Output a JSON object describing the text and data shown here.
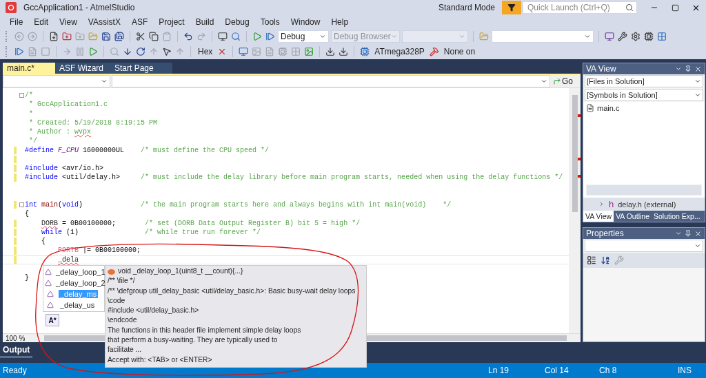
{
  "window": {
    "title": "GccApplication1 - AtmelStudio",
    "mode": "Standard Mode",
    "quick_launch": {
      "placeholder": "Quick Launch (Ctrl+Q)"
    }
  },
  "menu": [
    "File",
    "Edit",
    "View",
    "VAssistX",
    "ASF",
    "Project",
    "Build",
    "Debug",
    "Tools",
    "Window",
    "Help"
  ],
  "toolbar_1": {
    "configuration": "Debug",
    "debug_browser": "Debug Browser"
  },
  "toolbar_2": {
    "hex": "Hex",
    "device": "ATmega328P",
    "tool": "None on"
  },
  "document_tabs": [
    {
      "label": "main.c*",
      "selected": true
    },
    {
      "label": "ASF Wizard",
      "selected": false
    },
    {
      "label": "Start Page",
      "selected": false
    }
  ],
  "editor": {
    "go": "Go",
    "zoom": "100 %",
    "lines": [
      {
        "changed": false,
        "fold": true,
        "current": false,
        "segments": [
          {
            "text": "/*",
            "kind": "comment"
          }
        ]
      },
      {
        "changed": false,
        "fold": false,
        "current": false,
        "segments": [
          {
            "text": " * GccApplication1.c",
            "kind": "comment"
          }
        ]
      },
      {
        "changed": false,
        "fold": false,
        "current": false,
        "segments": [
          {
            "text": " *",
            "kind": "comment"
          }
        ]
      },
      {
        "changed": false,
        "fold": false,
        "current": false,
        "segments": [
          {
            "text": " * Created: 5/19/2018 8:19:15 PM",
            "kind": "comment"
          }
        ]
      },
      {
        "changed": false,
        "fold": false,
        "current": false,
        "segments": [
          {
            "text": " * Author : ",
            "kind": "comment"
          },
          {
            "text": "wvpx",
            "kind": "comment_error"
          }
        ]
      },
      {
        "changed": false,
        "fold": false,
        "current": false,
        "segments": [
          {
            "text": " */",
            "kind": "comment"
          }
        ]
      },
      {
        "changed": true,
        "fold": false,
        "current": false,
        "segments": [
          {
            "text": "#define ",
            "kind": "keyword"
          },
          {
            "text": "F_CPU",
            "kind": "macro"
          },
          {
            "text": " 16000000UL    ",
            "kind": "plain"
          },
          {
            "text": "/* must define the CPU speed */",
            "kind": "comment"
          }
        ]
      },
      {
        "changed": true,
        "fold": false,
        "current": false
      },
      {
        "changed": true,
        "fold": false,
        "current": false,
        "segments": [
          {
            "text": "#include",
            "kind": "keyword"
          },
          {
            "text": " <avr/io.h>",
            "kind": "plain"
          }
        ]
      },
      {
        "changed": true,
        "fold": false,
        "current": false,
        "segments": [
          {
            "text": "#include",
            "kind": "keyword"
          },
          {
            "text": " <util/delay.h>     ",
            "kind": "plain"
          },
          {
            "text": "/* must include the delay library before main program starts, needed when using the delay functions */",
            "kind": "comment"
          }
        ]
      },
      {
        "changed": false,
        "fold": false,
        "current": false
      },
      {
        "changed": false,
        "fold": false,
        "current": false
      },
      {
        "changed": true,
        "fold": true,
        "current": false,
        "segments": [
          {
            "text": "int ",
            "kind": "keyword"
          },
          {
            "text": "main",
            "kind": "function"
          },
          {
            "text": "(",
            "kind": "plain"
          },
          {
            "text": "void",
            "kind": "keyword"
          },
          {
            "text": ")              ",
            "kind": "plain"
          },
          {
            "text": "/* the main program starts here and always begins with int main(void)    */",
            "kind": "comment"
          }
        ]
      },
      {
        "changed": false,
        "fold": false,
        "current": false,
        "segments": [
          {
            "text": "{",
            "kind": "plain"
          }
        ]
      },
      {
        "changed": true,
        "fold": false,
        "current": false,
        "segments": [
          {
            "text": "    DORB",
            "kind": "error"
          },
          {
            "text": " = 0B00100000;       ",
            "kind": "plain"
          },
          {
            "text": "/* set (DORB Data Output Register B) bit 5 = high */",
            "kind": "comment"
          }
        ]
      },
      {
        "changed": true,
        "fold": false,
        "current": false,
        "segments": [
          {
            "text": "    while",
            "kind": "keyword"
          },
          {
            "text": " (1)                ",
            "kind": "plain"
          },
          {
            "text": "/* while true run forever */",
            "kind": "comment"
          }
        ]
      },
      {
        "changed": true,
        "fold": false,
        "current": false,
        "segments": [
          {
            "text": "    {",
            "kind": "plain"
          }
        ]
      },
      {
        "changed": true,
        "fold": false,
        "current": false,
        "segments": [
          {
            "text": "        PORTB",
            "kind": "register"
          },
          {
            "text": " |= 0B00100000;",
            "kind": "plain"
          }
        ]
      },
      {
        "changed": true,
        "fold": false,
        "current": true,
        "segments": [
          {
            "text": "        _dela",
            "kind": "error"
          }
        ]
      },
      {
        "changed": false,
        "fold": false,
        "current": false
      },
      {
        "changed": false,
        "fold": false,
        "current": false,
        "segments": [
          {
            "text": "}",
            "kind": "plain"
          }
        ]
      }
    ]
  },
  "completion": {
    "items": [
      {
        "label": "_delay_loop_1",
        "selected": false
      },
      {
        "label": "_delay_loop_2",
        "selected": false
      },
      {
        "label": "_delay_ms",
        "selected": true
      },
      {
        "label": "_delay_us",
        "selected": false
      }
    ],
    "filter": "A*",
    "signature": "void _delay_loop_1(uint8_t __count){...}",
    "doc": [
      "/** \\file */",
      "/** \\defgroup util_delay_basic <util/delay_basic.h>: Basic busy-wait delay loops",
      "\\code",
      "#include <util/delay_basic.h>",
      "\\endcode",
      "The functions in this header file implement simple delay loops",
      "that perform a busy-waiting. They are typically used to",
      "facilitate ...",
      "Accept with: <TAB> or <ENTER>"
    ]
  },
  "va_view": {
    "title": "VA View",
    "files": "[Files in Solution]",
    "symbols": "[Symbols in Solution]",
    "files_list": [
      "main.c"
    ],
    "external_glyph": "h",
    "external": "delay.h (external)",
    "tabs": [
      {
        "label": "VA View",
        "selected": true
      },
      {
        "label": "VA Outline",
        "selected": false
      },
      {
        "label": "Solution Exp...",
        "selected": false
      }
    ]
  },
  "properties": {
    "title": "Properties"
  },
  "output": {
    "title": "Output"
  },
  "status_bar": {
    "state": "Ready",
    "line": "Ln 19",
    "column": "Col 14",
    "char": "Ch 8",
    "mode": "INS"
  }
}
